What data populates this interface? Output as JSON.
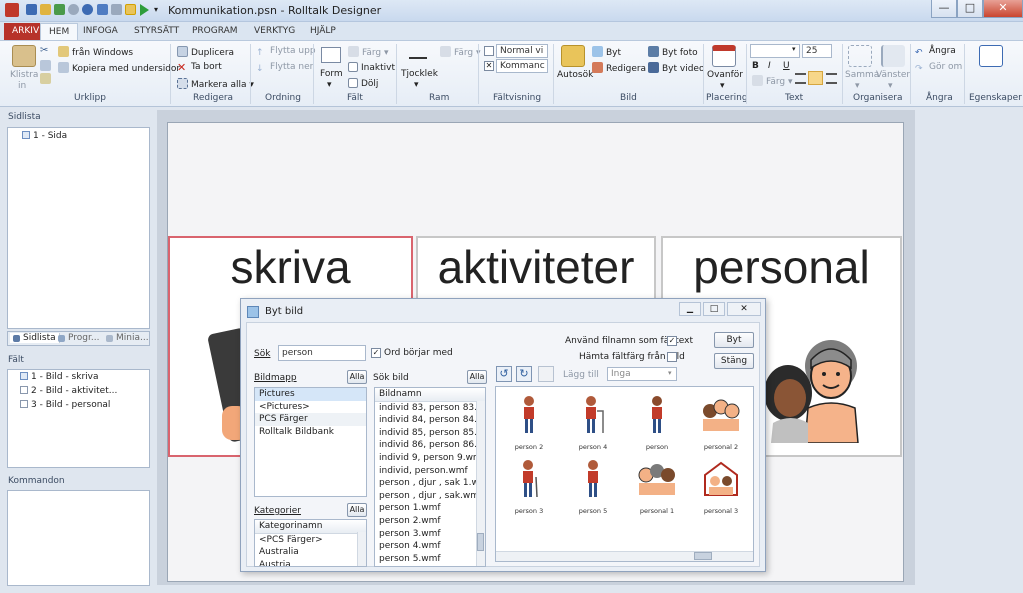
{
  "window": {
    "title": "Kommunikation.psn - Rolltalk Designer",
    "controls": {
      "minimize": "—",
      "maximize": "□",
      "close": "✕"
    }
  },
  "tabs": [
    {
      "label": "ARKIV"
    },
    {
      "label": "HEM"
    },
    {
      "label": "INFOGA"
    },
    {
      "label": "STYRSÄTT"
    },
    {
      "label": "PROGRAM"
    },
    {
      "label": "VERKTYG"
    },
    {
      "label": "HJÄLP"
    }
  ],
  "ribbon": {
    "urklipp": {
      "paste": "Klistra",
      "paste2": "in",
      "from_windows": "från Windows",
      "copy_with_sub": "Kopiera med undersidor",
      "label": "Urklipp"
    },
    "redigera": {
      "duplicate": "Duplicera",
      "delete": "Ta bort",
      "select_all": "Markera alla",
      "label": "Redigera"
    },
    "ordning": {
      "move_up": "Flytta upp",
      "move_down": "Flytta ner",
      "label": "Ordning"
    },
    "falt": {
      "form": "Form",
      "color": "Färg",
      "inactive": "Inaktivt",
      "hide": "Dölj",
      "label": "Fält"
    },
    "ram": {
      "thickness": "Tjocklek",
      "color": "Färg",
      "label": "Ram"
    },
    "faltvisning": {
      "view1": "Normal vi",
      "view2": "Kommanc",
      "label": "Fältvisning"
    },
    "bild": {
      "autosearch": "Autosök",
      "replace": "Byt",
      "edit": "Redigera",
      "replace_photo": "Byt foto",
      "replace_video": "Byt video",
      "label": "Bild"
    },
    "placering": {
      "above": "Ovanför",
      "label": "Placering"
    },
    "text": {
      "font": "",
      "size": "25",
      "bold": "B",
      "italic": "I",
      "underline": "U",
      "color": "Färg",
      "label": "Text"
    },
    "organisera": {
      "same": "Samma",
      "left": "Vänster",
      "label": "Organisera"
    },
    "angra": {
      "undo": "Ångra",
      "redo": "Gör om",
      "label": "Ångra"
    },
    "egenskaper": {
      "label": "Egenskaper"
    }
  },
  "sidlista": {
    "header": "Sidlista",
    "items": [
      "1 - Sida"
    ],
    "tabs": [
      "Sidlista",
      "Progr...",
      "Minia..."
    ]
  },
  "falt_panel": {
    "header": "Fält",
    "items": [
      "1 - Bild - skriva",
      "2 - Bild - aktivitet...",
      "3 - Bild - personal"
    ]
  },
  "kommandon": {
    "header": "Kommandon"
  },
  "cards": [
    {
      "word": "skriva"
    },
    {
      "word": "aktiviteter"
    },
    {
      "word": "personal"
    }
  ],
  "dialog": {
    "title": "Byt bild",
    "search_label": "Sök",
    "search_value": "person",
    "starts_with": "Ord börjar med",
    "use_filename": "Använd filnamn som fälttext",
    "fetch_color": "Hämta fältfärg från bild",
    "btn_replace": "Byt",
    "btn_close": "Stäng",
    "add_to": "Lägg till",
    "none": "Inga",
    "folder_label": "Bildmapp",
    "all": "Alla",
    "folders": [
      "Pictures",
      "<Pictures>",
      "PCS Färger",
      "Rolltalk Bildbank"
    ],
    "category_label": "Kategorier",
    "categories": [
      "Kategorinamn",
      "<PCS Färger>",
      "Australia",
      "Austria"
    ],
    "results_label": "Sök bild",
    "results": [
      "Bildnamn",
      "individ 83, person 83.w...",
      "individ 84, person 84.w...",
      "individ 85, person 85.w...",
      "individ 86, person 86.w...",
      "individ 9, person 9.wmf",
      "individ, person.wmf",
      "person , djur , sak 1.wmf",
      "person , djur , sak.wmf",
      "person 1.wmf",
      "person 2.wmf",
      "person 3.wmf",
      "person 4.wmf",
      "person 5.wmf"
    ],
    "thumbnails": [
      "person 2",
      "person 4",
      "person",
      "personal 2",
      "person 3",
      "person 5",
      "personal 1",
      "personal 3"
    ]
  }
}
